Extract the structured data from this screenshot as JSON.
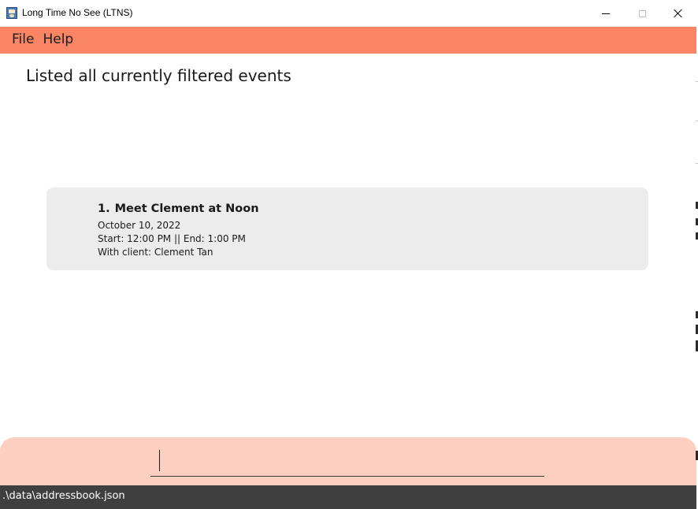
{
  "window": {
    "title": "Long Time No See (LTNS)",
    "icon": "app-icon"
  },
  "menu": {
    "items": [
      "File",
      "Help"
    ]
  },
  "result_display": {
    "text": "Listed all currently filtered events"
  },
  "events": [
    {
      "index": "1.",
      "title": "Meet Clement at Noon",
      "date": "October 10, 2022",
      "time": "Start: 12:00 PM || End: 1:00 PM",
      "client": "With client: Clement Tan"
    }
  ],
  "command_box": {
    "value": "",
    "placeholder": ""
  },
  "status_bar": {
    "path": ".\\data\\addressbook.json"
  },
  "colors": {
    "menu_bar": "#fa8564",
    "command_area": "#fdcfc0",
    "card": "#ececec",
    "status_bar": "#3f3f3f"
  }
}
